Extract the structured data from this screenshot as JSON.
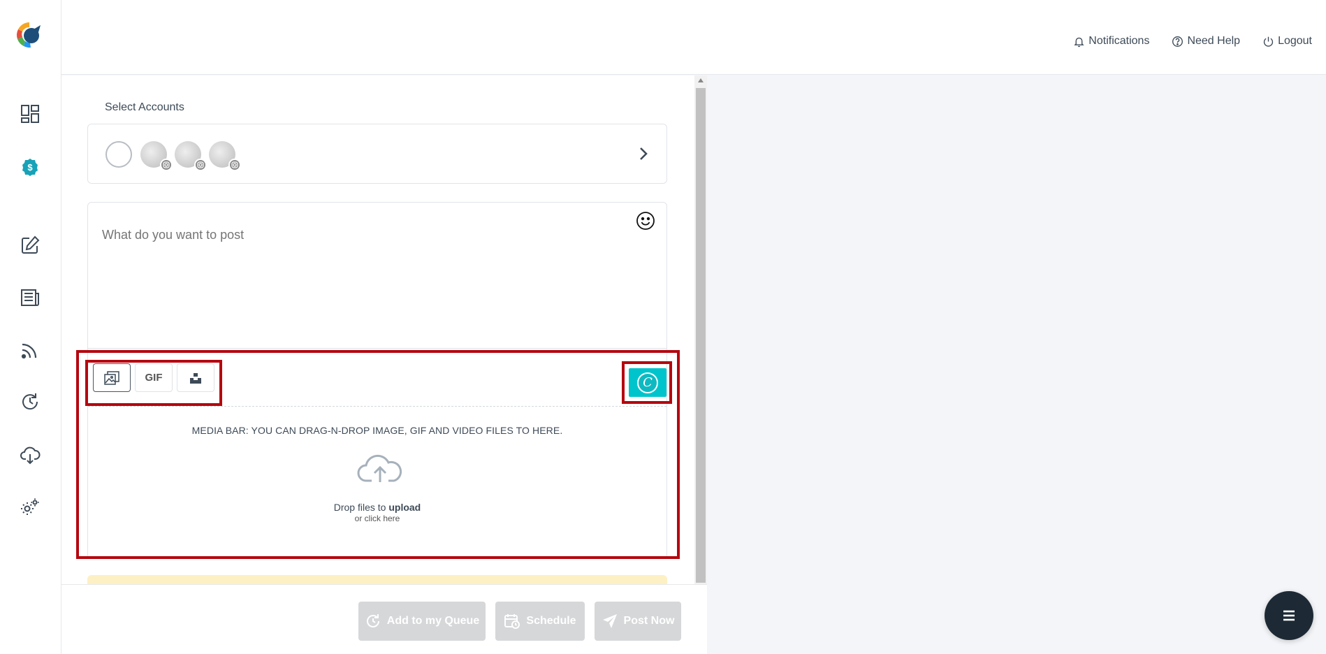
{
  "header": {
    "notifications_label": "Notifications",
    "help_label": "Need Help",
    "logout_label": "Logout"
  },
  "sidebar": {
    "items": [
      {
        "name": "dashboard-icon"
      },
      {
        "name": "billing-icon"
      },
      {
        "name": "compose-icon"
      },
      {
        "name": "posts-icon"
      },
      {
        "name": "rss-feed-icon"
      },
      {
        "name": "queue-icon"
      },
      {
        "name": "download-icon"
      },
      {
        "name": "settings-icon"
      }
    ]
  },
  "composer": {
    "select_accounts_label": "Select Accounts",
    "post_placeholder": "What do you want to post",
    "media_tools": {
      "gif_label": "GIF"
    },
    "canva_letter": "C",
    "dropzone": {
      "title": "MEDIA BAR: YOU CAN DRAG-N-DROP IMAGE, GIF AND VIDEO FILES TO HERE.",
      "line1_prefix": "Drop files to ",
      "line1_bold": "upload",
      "line2": "or click here"
    }
  },
  "footer": {
    "queue_label": "Add to my Queue",
    "schedule_label": "Schedule",
    "post_now_label": "Post Now"
  },
  "colors": {
    "highlight": "#b5070f",
    "canva": "#00c4cc",
    "disabled_button": "#d6d7d9",
    "fab": "#1d2a36"
  }
}
